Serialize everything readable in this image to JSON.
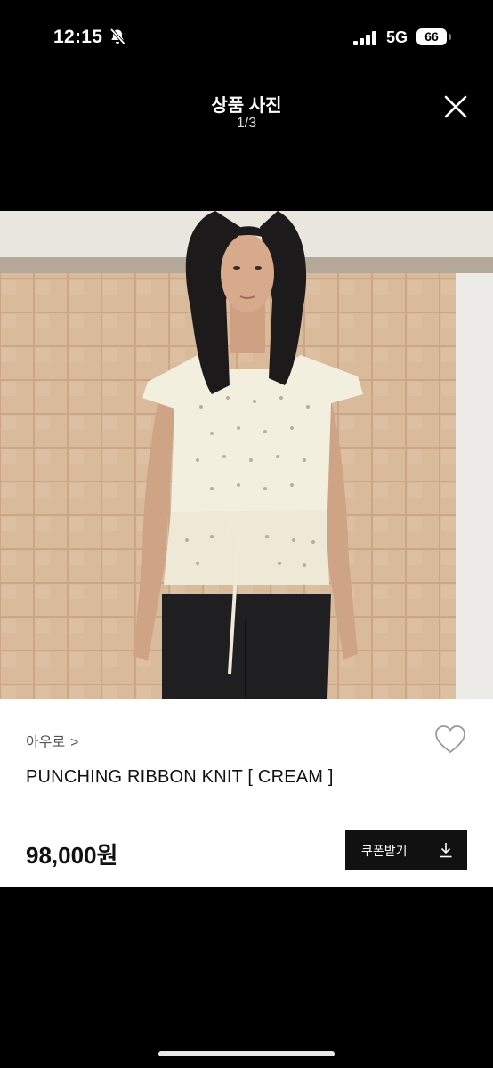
{
  "status_bar": {
    "time": "12:15",
    "network": "5G",
    "battery": "66",
    "icons": [
      "bell-slash-icon",
      "signal-icon",
      "battery-icon"
    ]
  },
  "viewer": {
    "title": "상품 사진",
    "counter": "1/3",
    "close_icon": "close-icon"
  },
  "product": {
    "brand": "아우로",
    "brand_chevron": ">",
    "name": "PUNCHING RIBBON KNIT [ CREAM ]",
    "price": "98,000원",
    "coupon_label": "쿠폰받기",
    "wishlist_icon": "heart-outline-icon",
    "coupon_icon": "download-icon"
  },
  "colors": {
    "background": "#000000",
    "card": "#ffffff",
    "button": "#111111",
    "text": "#111111",
    "muted": "#555555"
  }
}
